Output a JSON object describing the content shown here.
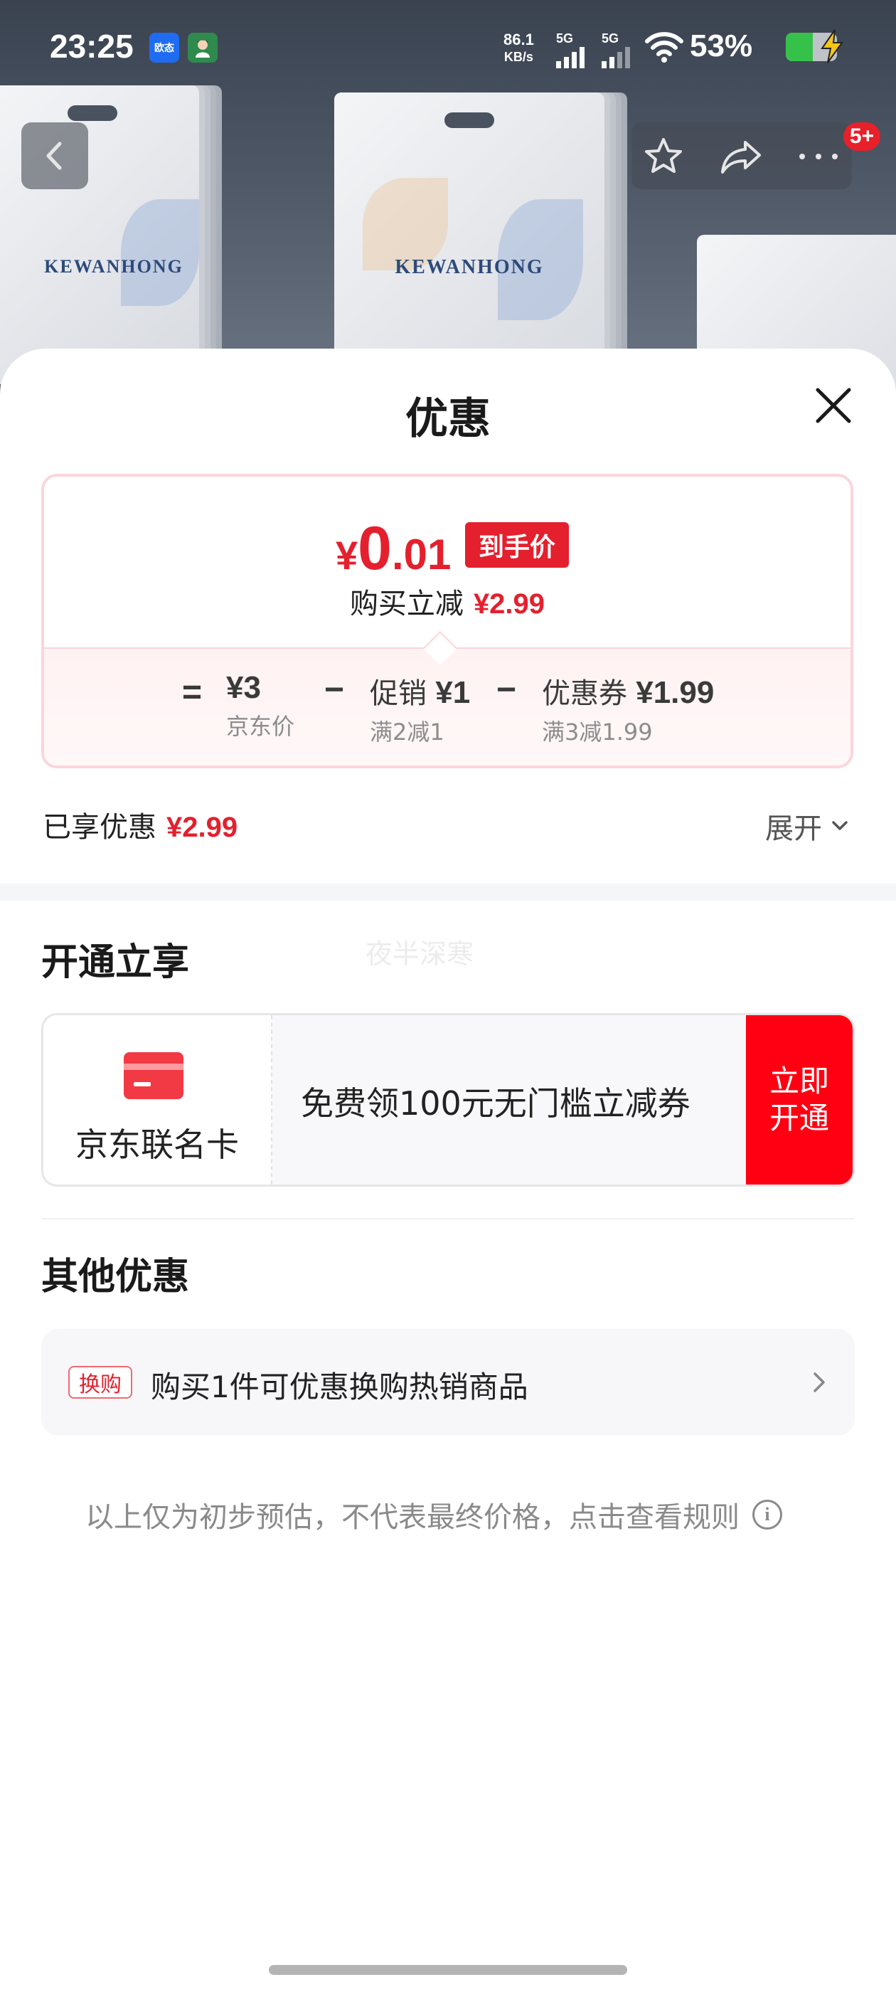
{
  "status_bar": {
    "time": "23:25",
    "app_icon_1": "欧态",
    "net_speed_value": "86.1",
    "net_speed_unit": "KB/s",
    "sim1_label": "5G",
    "sim2_label": "5G",
    "battery_percent": "53%",
    "battery_level": 0.53
  },
  "hero": {
    "brand_text": "KEWANHONG",
    "notification_badge": "5+"
  },
  "sheet": {
    "title": "优惠",
    "price_card": {
      "currency": "¥",
      "price_int": "0",
      "price_dec": ".01",
      "final_tag": "到手价",
      "reduce_label": "购买立减",
      "reduce_amount": "¥2.99",
      "equals": "=",
      "minus": "−",
      "jd_price": "¥3",
      "jd_price_label": "京东价",
      "promo_label": "促销",
      "promo_amount": "¥1",
      "promo_rule": "满2减1",
      "coupon_label": "优惠券",
      "coupon_amount": "¥1.99",
      "coupon_rule": "满3减1.99"
    },
    "enjoyed_label": "已享优惠",
    "enjoyed_amount": "¥2.99",
    "expand_label": "展开",
    "open_section_title": "开通立享",
    "watermark": "夜半深寒",
    "card_offer": {
      "card_name": "京东联名卡",
      "offer_text": "免费领100元无门槛立减券",
      "button_line1": "立即",
      "button_line2": "开通"
    },
    "other_section_title": "其他优惠",
    "other_item": {
      "tag": "换购",
      "text": "购买1件可优惠换购热销商品"
    },
    "disclaimer": "以上仅为初步预估，不代表最终价格，点击查看规则"
  },
  "colors": {
    "accent_red": "#e4202e",
    "button_red": "#ff0012",
    "card_border": "#fbd5da"
  }
}
